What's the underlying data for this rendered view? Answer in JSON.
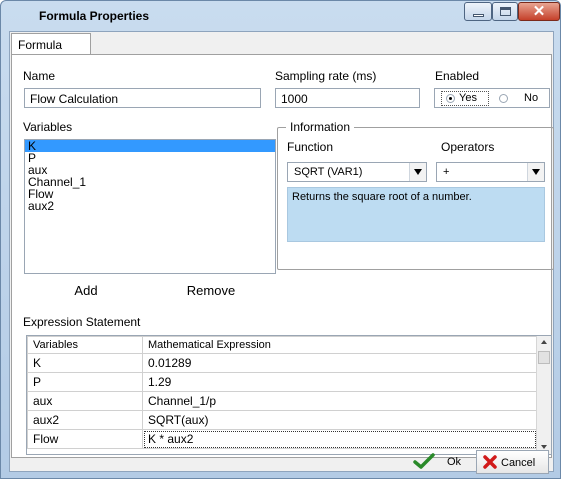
{
  "window": {
    "title": "Formula Properties"
  },
  "tabs": [
    {
      "label": "Formula"
    }
  ],
  "name_field": {
    "label": "Name",
    "value": "Flow Calculation"
  },
  "sampling": {
    "label": "Sampling rate (ms)",
    "value": "1000"
  },
  "enabled": {
    "label": "Enabled",
    "options": [
      "Yes",
      "No"
    ],
    "selected": "Yes"
  },
  "variables": {
    "label": "Variables",
    "items": [
      "K",
      "P",
      "aux",
      "Channel_1",
      "Flow",
      "aux2"
    ],
    "selected": "K",
    "add_label": "Add",
    "remove_label": "Remove"
  },
  "information": {
    "title": "Information",
    "function_label": "Function",
    "function_value": "SQRT  (VAR1)",
    "operators_label": "Operators",
    "operators_value": "+",
    "description": "Returns the square root of a number."
  },
  "expression": {
    "label": "Expression Statement",
    "columns": [
      "Variables",
      "Mathematical Expression"
    ],
    "rows": [
      [
        "K",
        "0.01289"
      ],
      [
        "P",
        "1.29"
      ],
      [
        "aux",
        "Channel_1/p"
      ],
      [
        "aux2",
        "SQRT(aux)"
      ],
      [
        "Flow",
        "K * aux2"
      ]
    ]
  },
  "footer": {
    "ok_label": "Ok",
    "cancel_label": "Cancel"
  },
  "colors": {
    "selection": "#3399ff",
    "description_bg": "#bddcf2",
    "ok_check": "#2a8a2a",
    "cancel_x": "#d11a1a"
  }
}
